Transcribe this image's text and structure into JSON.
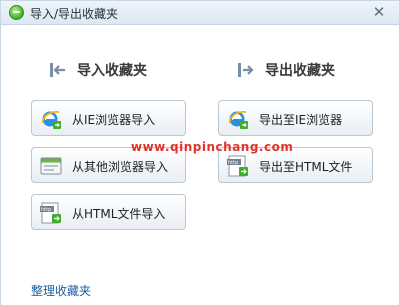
{
  "window": {
    "title": "导入/导出收藏夹",
    "close_symbol": "✕"
  },
  "import_section": {
    "heading": "导入收藏夹",
    "buttons": [
      {
        "label": "从IE浏览器导入",
        "icon": "ie-icon"
      },
      {
        "label": "从其他浏览器导入",
        "icon": "browser-window-icon"
      },
      {
        "label": "从HTML文件导入",
        "icon": "html-file-icon"
      }
    ]
  },
  "export_section": {
    "heading": "导出收藏夹",
    "buttons": [
      {
        "label": "导出至IE浏览器",
        "icon": "ie-icon"
      },
      {
        "label": "导出至HTML文件",
        "icon": "html-file-icon"
      }
    ]
  },
  "watermark": "www.qinpinchang.com",
  "footer": {
    "organize_link": "整理收藏夹"
  },
  "colors": {
    "accent": "#1f5c9c",
    "watermark": "#e0342a",
    "title_bar": "#e3ecf5"
  }
}
